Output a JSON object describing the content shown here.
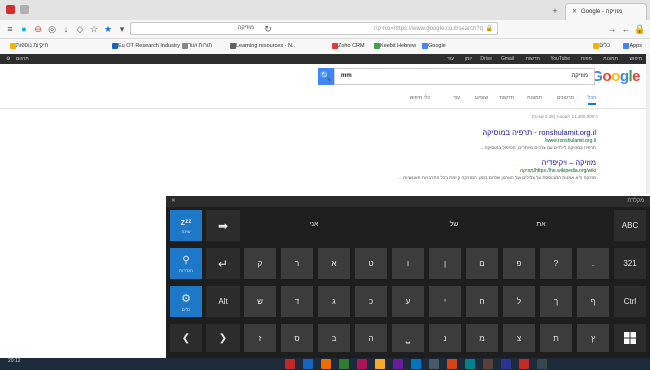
{
  "browser": {
    "tab_active": "Google - מוזיקה",
    "tab_other": "",
    "window_controls": [
      "—",
      "❐",
      "✕"
    ],
    "new_tab": "+",
    "url": "https://www.google.co.il/search?q=מוזיקה",
    "search_value": "מוזיקה"
  },
  "bookmarks": [
    {
      "label": "Apps",
      "color": "#4285f4"
    },
    {
      "label": "כלים",
      "color": "#f4b400"
    },
    {
      "label": "Eu OT Research Industry",
      "color": "#1565c0"
    },
    {
      "label": "תורות ועוד",
      "color": "#888888"
    },
    {
      "label": "Learning resources - N..",
      "color": "#5f6368"
    },
    {
      "label": "Zoho CRM",
      "color": "#e53935"
    },
    {
      "label": "Keebit Hebrew",
      "color": "#43a047"
    },
    {
      "label": "Google",
      "color": "#4285f4"
    },
    {
      "label": "תיקיות נוספות",
      "color": "#f4b400"
    }
  ],
  "gbar": {
    "left": "תרגום",
    "items": [
      "חיפוש",
      "תמונות",
      "מפות",
      "YouTube",
      "חדשות",
      "Gmail",
      "Drive",
      "יומן",
      "עוד"
    ]
  },
  "google": {
    "logo": [
      {
        "ch": "G",
        "color": "#4285f4"
      },
      {
        "ch": "o",
        "color": "#ea4335"
      },
      {
        "ch": "o",
        "color": "#fbbc05"
      },
      {
        "ch": "g",
        "color": "#4285f4"
      },
      {
        "ch": "l",
        "color": "#34a853"
      },
      {
        "ch": "e",
        "color": "#ea4335"
      }
    ],
    "query_value": "mm",
    "query_term": "מוזיקה",
    "tabs": [
      "הכל",
      "סרטונים",
      "תמונות",
      "חדשות",
      "שופינג",
      "עוד",
      "כלי חיפוש"
    ],
    "results_count": "כ-11,300,000 תוצאות (0.35 שניות)",
    "results": [
      {
        "title": "ronshulamit.org.il - תרפיה במוסיקה",
        "url": "www.ronshulamit.org.il/",
        "snippet": "תרפיה במוזיקה לילדים עם צרכים מיוחדים, הטיפול במוסיקה ..."
      },
      {
        "title": "מוזיקה – ויקיפדיה",
        "url": "https://he.wikipedia.org/wiki/מוזיקה",
        "snippet": "מוזיקה היא אמנות המבוססת על צלילים ועל הארגון שלהם בזמן. המוזיקה קיימת בכל התרבויות האנושיות ..."
      }
    ]
  },
  "keyboard": {
    "window_title": "מקלדת",
    "close": "✕",
    "suggestions": [
      "אני",
      "של",
      "את"
    ],
    "left_keys": [
      {
        "icon": "zᶻᶻ",
        "label": "שינה",
        "icon_name": "sleep-icon"
      },
      {
        "icon": "⚲",
        "label": "הגדרות",
        "icon_name": "pin-icon"
      },
      {
        "icon": "⚙",
        "label": "כלים",
        "icon_name": "gear-icon"
      }
    ],
    "row_arrows": [
      "➡",
      "↵"
    ],
    "row1": [
      "ק",
      "ר",
      "א",
      "ט",
      "ו",
      "ן",
      "ם",
      "פ",
      "?",
      "."
    ],
    "row2": [
      "ש",
      "ד",
      "ג",
      "כ",
      "ע",
      "י",
      "ח",
      "ל",
      "ך",
      "ף"
    ],
    "row3": [
      "ז",
      "ס",
      "ב",
      "ה",
      "נ",
      "מ",
      "צ",
      "ת",
      "ץ"
    ],
    "alt": "Alt",
    "abc": "ABC",
    "nums": "321",
    "ctrl": "Ctrl",
    "space": "⎵",
    "nav_left": "❮",
    "nav_right": "❯"
  },
  "taskbar": {
    "time": "20:12",
    "date": "16/06/2016",
    "apps": [
      "#c62828",
      "#1565c0",
      "#ef6c00",
      "#2e7d32",
      "#ad1457",
      "#f9a825",
      "#6a1b9a",
      "#0277bd",
      "#455a64",
      "#d84315",
      "#00838f",
      "#5d4037",
      "#283593",
      "#c62828",
      "#37474f"
    ]
  }
}
